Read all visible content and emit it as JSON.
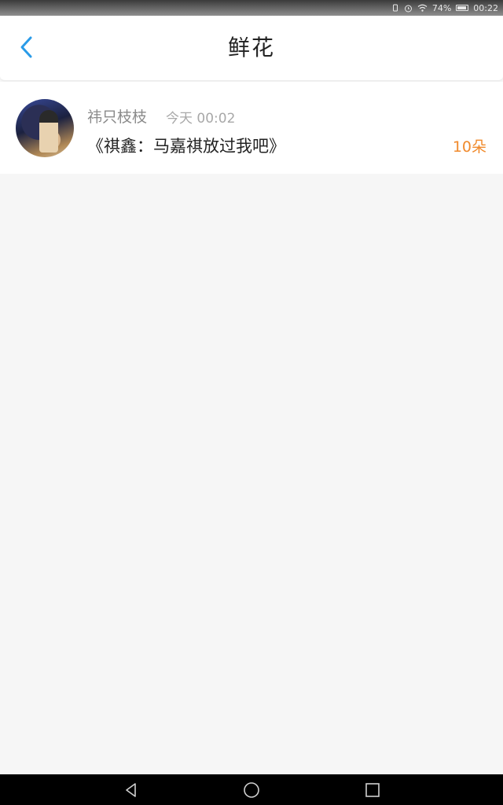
{
  "status_bar": {
    "battery": "74%",
    "time": "00:22",
    "icons": [
      "vibrate-icon",
      "alarm-icon",
      "wifi-icon",
      "battery-icon"
    ]
  },
  "header": {
    "title": "鲜花",
    "back_icon": "chevron-left-icon",
    "accent_color": "#2a9be8"
  },
  "records": [
    {
      "username": "祎只枝枝",
      "time": "今天 00:02",
      "message": "《祺鑫：马嘉祺放过我吧》",
      "flowers": "10朵",
      "flowers_color": "#f08a2c"
    }
  ],
  "nav_bar": {
    "icons": [
      "back-triangle-icon",
      "home-circle-icon",
      "recents-square-icon"
    ]
  }
}
